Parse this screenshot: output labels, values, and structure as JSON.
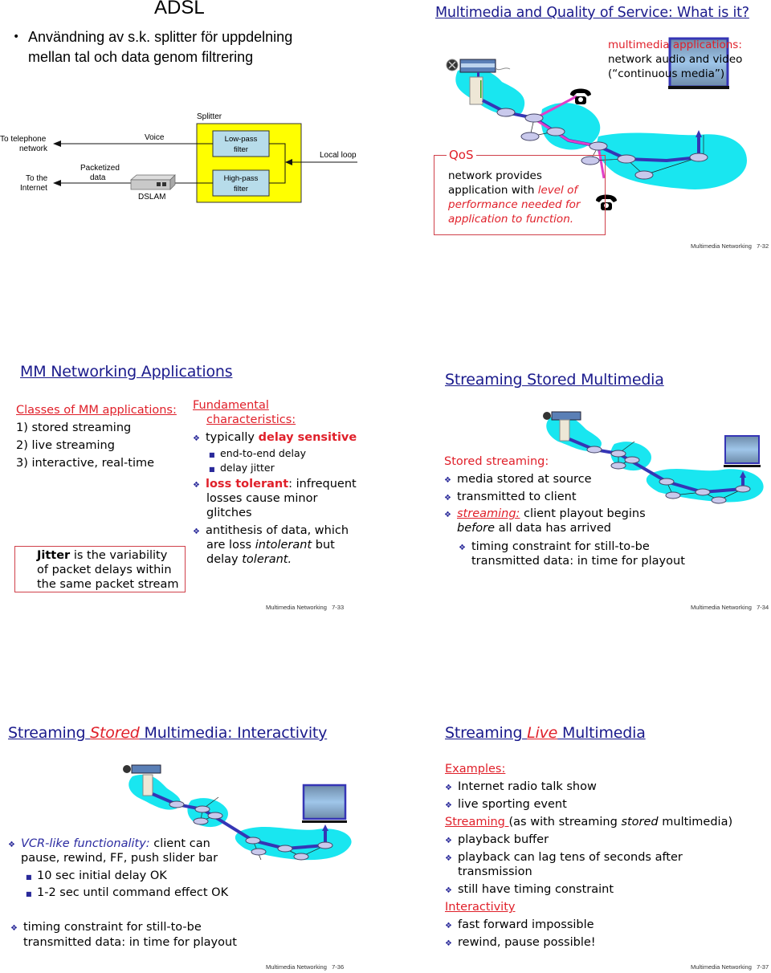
{
  "slides": {
    "adsl": {
      "title": "ADSL",
      "bullet_line1": "Användning av s.k. splitter för uppdelning",
      "bullet_line2": "mellan tal och data genom filtrering",
      "diagram": {
        "splitter": "Splitter",
        "voice": "Voice",
        "to_tel_1": "To telephone",
        "to_tel_2": "network",
        "packetized_1": "Packetized",
        "packetized_2": "data",
        "to_inet_1": "To the",
        "to_inet_2": "Internet",
        "dslam": "DSLAM",
        "lowpass_1": "Low-pass",
        "lowpass_2": "filter",
        "highpass_1": "High-pass",
        "highpass_2": "filter",
        "local_loop": "Local loop"
      }
    },
    "s32": {
      "title": "Multimedia and Quality of Service: What is it?",
      "mm_label": "multimedia applications:",
      "mm_line2": "network audio and video",
      "mm_line3": "(“continuous media”)",
      "qos_label": "QoS",
      "qos_line1": "network provides",
      "qos_line2a": "application with ",
      "qos_line2b": "level of",
      "qos_line3": "performance needed for",
      "qos_line4": "application to function.",
      "footer_label": "Multimedia Networking",
      "footer_page": "7-32"
    },
    "s33": {
      "title": "MM Networking Applications",
      "classes_heading": "Classes of MM applications:",
      "classes": [
        "1) stored streaming",
        "2) live streaming",
        "3) interactive, real-time"
      ],
      "jitter_bold": "Jitter",
      "jitter_line1": " is the variability",
      "jitter_line2": "of packet delays within",
      "jitter_line3": "the same packet stream",
      "fund_heading_1": "Fundamental",
      "fund_heading_2": "characteristics:",
      "b1_a": "typically ",
      "b1_b": "delay sensitive",
      "sub1": "end-to-end delay",
      "sub2": "delay jitter",
      "b2_a": "loss tolerant",
      "b2_b": ": infrequent",
      "b2_l2": "losses cause minor",
      "b2_l3": "glitches",
      "b3_l1": "antithesis of data, which",
      "b3_l2a": "are loss ",
      "b3_l2b": "intolerant",
      "b3_l2c": " but",
      "b3_l3a": "delay ",
      "b3_l3b": "tolerant.",
      "footer_label": "Multimedia Networking",
      "footer_page": "7-33"
    },
    "s34": {
      "title": "Streaming Stored Multimedia",
      "heading": "Stored streaming:",
      "b1": "media stored at source",
      "b2": "transmitted to client",
      "b3_a": "streaming:",
      "b3_b": " client playout begins",
      "b3_l2a": "before",
      "b3_l2b": " all data has arrived",
      "sub_l1": "timing constraint for still-to-be",
      "sub_l2": "transmitted data: in time for playout",
      "footer_label": "Multimedia Networking",
      "footer_page": "7-34"
    },
    "s36": {
      "title_a": "Streaming ",
      "title_b": "Stored",
      "title_c": " Multimedia: Interactivity",
      "b1_a": "VCR-like functionality:",
      "b1_b": " client can",
      "b1_l2": "pause, rewind, FF, push slider bar",
      "sub1": "10 sec initial delay OK",
      "sub2": "1-2 sec until command effect OK",
      "b2_l1": "timing constraint for still-to-be",
      "b2_l2": "transmitted data: in time for playout",
      "footer_label": "Multimedia Networking",
      "footer_page": "7-36"
    },
    "s37": {
      "title_a": "Streaming ",
      "title_b": "Live",
      "title_c": " Multimedia",
      "examples_heading": "Examples:",
      "ex1": "Internet radio talk show",
      "ex2": "live sporting event",
      "streaming_heading": "Streaming ",
      "streaming_rest_a": "(as with streaming ",
      "streaming_rest_b": "stored",
      "streaming_rest_c": " multimedia)",
      "s1": "playback buffer",
      "s2_l1": "playback can lag tens of seconds after",
      "s2_l2": "transmission",
      "s3": "still have timing constraint",
      "interactivity_heading": "Interactivity",
      "i1": "fast forward impossible",
      "i2": "rewind, pause possible!",
      "footer_label": "Multimedia Networking",
      "footer_page": "7-37"
    }
  },
  "colors": {
    "title_blue": "#1a1a8c",
    "accent_red": "#e0202a",
    "cloud_cyan": "#19e6f0",
    "link_blue": "#3535b5",
    "link_magenta": "#e040c8",
    "splitter_yellow": "#ffff00",
    "filter_blue": "#b7dcea"
  }
}
